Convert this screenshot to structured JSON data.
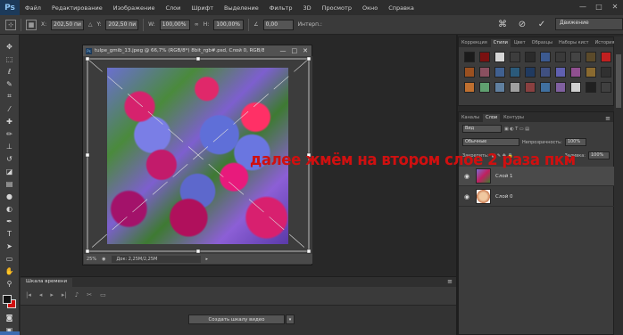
{
  "app": {
    "logo": "Ps"
  },
  "menu": {
    "items": [
      "Файл",
      "Редактирование",
      "Изображение",
      "Слои",
      "Шрифт",
      "Выделение",
      "Фильтр",
      "3D",
      "Просмотр",
      "Окно",
      "Справка"
    ]
  },
  "window_controls": {
    "minimize": "—",
    "maximize": "□",
    "close": "✕"
  },
  "options_bar": {
    "x_value": "202,50 пи",
    "y_value": "202,50 пи",
    "w_value": "100,00%",
    "h_value": "100,00%",
    "angle_value": "0,00",
    "interp_label": "Интерп.:",
    "workspace": "Движение"
  },
  "tools": [
    "move",
    "marquee",
    "lasso",
    "quick-select",
    "crop",
    "eyedropper",
    "heal",
    "brush",
    "stamp",
    "history-brush",
    "eraser",
    "gradient",
    "blur",
    "dodge",
    "pen",
    "type",
    "path-select",
    "shape",
    "hand",
    "zoom"
  ],
  "document": {
    "title": "tulpe_gmib_13.jpeg @ 66,7% (RGB/8*) 8bit_rgb#.psd, Слой 0, RGB/8*)",
    "zoom": "25%",
    "status": "Док: 2,25M/2,25M"
  },
  "timeline": {
    "tab_label": "Шкала времени",
    "create_label": "Создать шкалу видео",
    "controls": [
      "|◂",
      "◂",
      "▸",
      "▸|",
      "♪",
      "✂",
      "▭"
    ]
  },
  "swatches_panel": {
    "tabs": [
      "Коррекция",
      "Стили",
      "Цвет",
      "Образцы",
      "Наборы кист",
      "История"
    ],
    "active_tab": "Стили",
    "swatch_colors": [
      "#1b1b1b",
      "#7a1010",
      "#d7d7d7",
      "#3d3d3d",
      "#2b2b2b",
      "#3c5a90",
      "#3a3a3a",
      "#444",
      "#5b4a2a",
      "#c02020",
      "#9a5020",
      "#8a5060",
      "#406090",
      "#2b5a7a",
      "#203a60",
      "#405080",
      "#6060b0",
      "#905090",
      "#8a6a30",
      "#303030",
      "#c07030",
      "#60a070",
      "#6080a0",
      "#a0a0a0",
      "#8a4040",
      "#4070a0",
      "#8060a0",
      "#d0d0d0",
      "#202020",
      "#404040"
    ]
  },
  "layers_panel": {
    "tabs": [
      "Каналы",
      "Слои",
      "Контуры"
    ],
    "active_tab": "Слои",
    "kind_label": "Вид",
    "blend_mode": "Обычные",
    "opacity_label": "Непрозрачность:",
    "opacity_value": "100%",
    "lock_label": "Закрепить:",
    "fill_label": "Заливка:",
    "fill_value": "100%",
    "layers": [
      {
        "name": "Слой 1",
        "selected": true
      },
      {
        "name": "Слой 0",
        "selected": false
      }
    ]
  },
  "annotation": {
    "text": "далее жмём  на втором слое  2 раза пкм",
    "color": "#cf1010"
  }
}
